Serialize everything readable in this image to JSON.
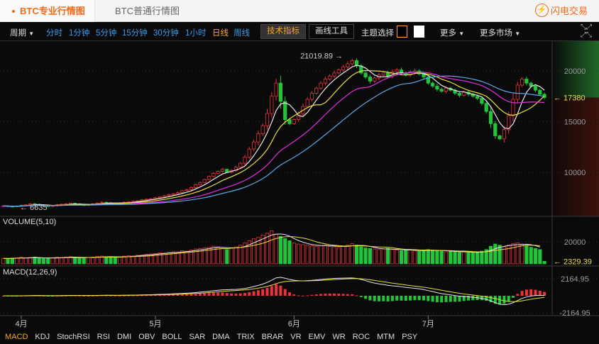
{
  "header": {
    "tabs": [
      "BTC专业行情图",
      "BTC普通行情图"
    ],
    "active_tab": 0,
    "logo": "闪电交易"
  },
  "toolbar": {
    "period": "周期",
    "intervals": [
      "分时",
      "1分钟",
      "5分钟",
      "15分钟",
      "30分钟",
      "1小时",
      "日线",
      "周线"
    ],
    "active_interval": "日线",
    "indicators_button": "技术指标",
    "drawing_button": "画线工具",
    "theme_label": "主题选择",
    "more": "更多",
    "more_markets": "更多市场"
  },
  "colors": {
    "up": "#e8343a",
    "down": "#22c53a",
    "ma5": "#e8e8e8",
    "ma10": "#e8e03a",
    "ma20": "#e030e0",
    "ma30": "#5aa8e8",
    "accent": "#f26a1b"
  },
  "chart_data": {
    "type": "candlestick",
    "x_start": "03-28",
    "x_ticks": [
      "4月",
      "5月",
      "6月",
      "7月"
    ],
    "price_axis": {
      "ticks": [
        10000,
        15000,
        20000
      ]
    },
    "annotations": {
      "high": "21019.89",
      "low": "6635",
      "last": "17380"
    },
    "closes": [
      6700,
      6650,
      6620,
      6680,
      6750,
      6800,
      6900,
      6850,
      6780,
      6700,
      6650,
      6720,
      6800,
      6850,
      6900,
      6950,
      6880,
      6800,
      6750,
      6820,
      6900,
      6980,
      7050,
      7000,
      6950,
      6900,
      6980,
      7050,
      7100,
      7150,
      7200,
      7300,
      7350,
      7400,
      7500,
      7600,
      7700,
      7800,
      7900,
      8000,
      8200,
      8300,
      8500,
      8800,
      9000,
      9300,
      9600,
      9900,
      10100,
      10300,
      10000,
      10200,
      10500,
      10900,
      11500,
      12300,
      13000,
      13800,
      14600,
      15800,
      17500,
      18800,
      17000,
      15200,
      14800,
      15200,
      15800,
      16500,
      17200,
      17800,
      18300,
      18800,
      19200,
      19500,
      19800,
      20100,
      20400,
      20700,
      21019,
      20500,
      19800,
      19400,
      19000,
      19300,
      19600,
      19800,
      19500,
      19900,
      20100,
      19800,
      19600,
      19900,
      20000,
      19700,
      19400,
      18800,
      18500,
      18200,
      18000,
      18300,
      18100,
      17800,
      17600,
      17900,
      17700,
      17500,
      17300,
      16800,
      16000,
      14800,
      13600,
      13300,
      14200,
      15600,
      17200,
      18600,
      19200,
      18800,
      18500,
      18100,
      17700,
      17380
    ],
    "volume_label": "VOLUME(5,10)",
    "volume_ticks": [
      20000
    ],
    "volume_last": "2329.39",
    "volumes": [
      5000,
      4800,
      5200,
      5500,
      6000,
      5500,
      5800,
      6200,
      5000,
      4800,
      5200,
      5600,
      6000,
      5800,
      6200,
      6500,
      6000,
      5500,
      5200,
      5800,
      6200,
      6800,
      7000,
      6500,
      6000,
      5800,
      6400,
      7000,
      7500,
      7200,
      7800,
      8200,
      8800,
      9000,
      9500,
      10000,
      9800,
      10500,
      11000,
      10800,
      12000,
      11500,
      12500,
      13500,
      14000,
      14500,
      15000,
      16000,
      15500,
      14000,
      13000,
      14500,
      15500,
      17000,
      19000,
      21000,
      23000,
      24000,
      26000,
      28000,
      30000,
      27000,
      25000,
      23000,
      21000,
      19000,
      18000,
      17500,
      17000,
      16500,
      16000,
      16500,
      17000,
      16000,
      15500,
      15000,
      16000,
      17000,
      18500,
      17000,
      15500,
      14500,
      14000,
      13500,
      13000,
      13500,
      14000,
      13000,
      12500,
      12000,
      12500,
      13000,
      12000,
      11500,
      12000,
      13000,
      12500,
      12000,
      11500,
      11000,
      11500,
      11000,
      10500,
      11000,
      10500,
      10000,
      10500,
      11500,
      13000,
      16000,
      18000,
      17000,
      15500,
      17000,
      18500,
      19000,
      18000,
      16500,
      15000,
      14000,
      13000,
      2329.39
    ],
    "macd_label": "MACD(12,26,9)",
    "macd_ticks": [
      "2164.95",
      "-2164.95"
    ]
  },
  "indicator_tabs": [
    "MACD",
    "KDJ",
    "StochRSI",
    "RSI",
    "DMI",
    "OBV",
    "BOLL",
    "SAR",
    "DMA",
    "TRIX",
    "BRAR",
    "VR",
    "EMV",
    "WR",
    "ROC",
    "MTM",
    "PSY"
  ],
  "active_indicator": "MACD"
}
